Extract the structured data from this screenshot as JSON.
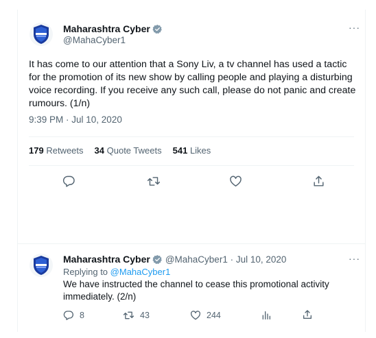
{
  "tweet": {
    "author_name": "Maharashtra Cyber",
    "author_handle": "@MahaCyber1",
    "more_label": "···",
    "text": "It has come to our attention that a Sony Liv, a tv channel has used a tactic for the promotion of its new show by calling people and playing a disturbing voice recording. If you receive any such call, please do not panic and create rumours. (1/n)",
    "timestamp": "9:39 PM · Jul 10, 2020",
    "stats": {
      "retweets_count": "179",
      "retweets_label": "Retweets",
      "quotes_count": "34",
      "quotes_label": "Quote Tweets",
      "likes_count": "541",
      "likes_label": "Likes"
    }
  },
  "reply": {
    "author_name": "Maharashtra Cyber",
    "handle_date": "@MahaCyber1 · Jul 10, 2020",
    "more_label": "···",
    "replying_label": "Replying to",
    "replying_handle": "@MahaCyber1",
    "text": "We have instructed the channel to cease this promotional activity immediately. (2/n)",
    "replies_count": "8",
    "retweets_count": "43",
    "likes_count": "244"
  },
  "colors": {
    "verified_badge": "#829aab",
    "link": "#1d9bf0",
    "secondary_text": "#536471",
    "avatar_shield": "#1a3b9e"
  }
}
